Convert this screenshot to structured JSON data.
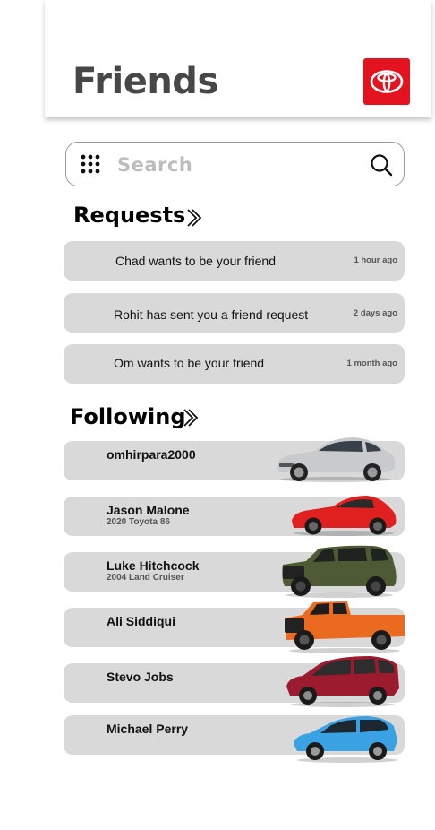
{
  "header": {
    "title": "Friends",
    "logo_icon": "toyota-logo-icon",
    "brand_color": "#e3141f"
  },
  "search": {
    "placeholder": "Search",
    "menu_icon": "grid-icon",
    "search_icon": "search-icon"
  },
  "requests": {
    "title": "Requests",
    "items": [
      {
        "text": "Chad wants to be your friend",
        "time": "1 hour ago"
      },
      {
        "text": "Rohit has sent you a friend request",
        "time": "2 days ago"
      },
      {
        "text": "Om wants to be your friend",
        "time": "1 month ago"
      }
    ]
  },
  "following": {
    "title": "Following",
    "items": [
      {
        "name": "omhirpara2000",
        "subtitle": "",
        "car_color": "#c9cacc"
      },
      {
        "name": "Jason Malone",
        "subtitle": "2020 Toyota 86",
        "car_color": "#e0201e"
      },
      {
        "name": "Luke Hitchcock",
        "subtitle": "2004 Land Cruiser",
        "car_color": "#4d5a34"
      },
      {
        "name": "Ali Siddiqui",
        "subtitle": "",
        "car_color": "#ea6a1f"
      },
      {
        "name": "Stevo Jobs",
        "subtitle": "",
        "car_color": "#9c1b2e"
      },
      {
        "name": "Michael Perry",
        "subtitle": "",
        "car_color": "#3aa2e2"
      }
    ]
  }
}
